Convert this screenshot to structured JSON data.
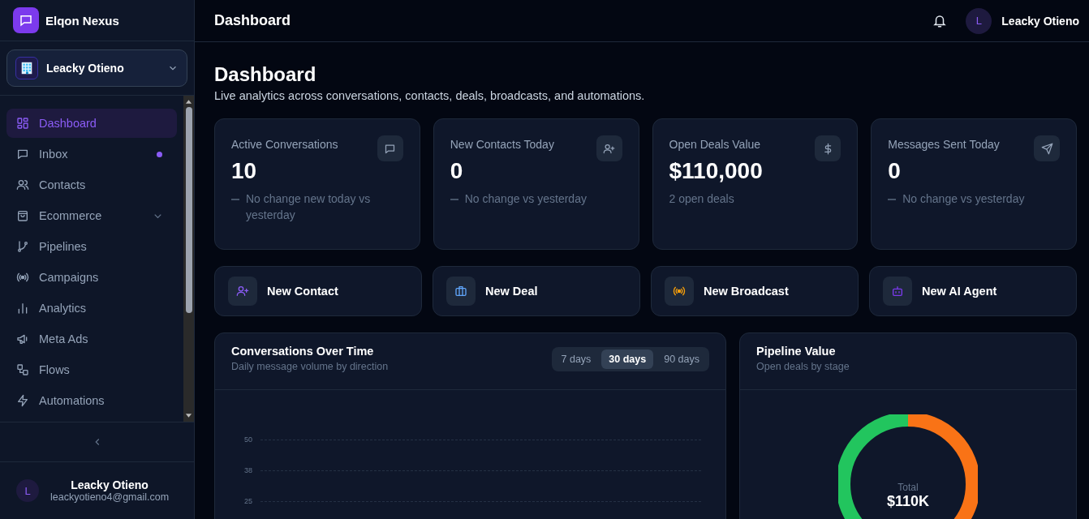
{
  "brand": {
    "name": "Elqon Nexus"
  },
  "workspace": {
    "name": "Leacky Otieno"
  },
  "sidebar": {
    "items": [
      {
        "label": "Dashboard",
        "selected": true,
        "unread": false,
        "has_submenu": false
      },
      {
        "label": "Inbox",
        "selected": false,
        "unread": true,
        "has_submenu": false
      },
      {
        "label": "Contacts",
        "selected": false,
        "unread": false,
        "has_submenu": false
      },
      {
        "label": "Ecommerce",
        "selected": false,
        "unread": false,
        "has_submenu": true
      },
      {
        "label": "Pipelines",
        "selected": false,
        "unread": false,
        "has_submenu": false
      },
      {
        "label": "Campaigns",
        "selected": false,
        "unread": false,
        "has_submenu": false
      },
      {
        "label": "Analytics",
        "selected": false,
        "unread": false,
        "has_submenu": false
      },
      {
        "label": "Meta Ads",
        "selected": false,
        "unread": false,
        "has_submenu": false
      },
      {
        "label": "Flows",
        "selected": false,
        "unread": false,
        "has_submenu": false
      },
      {
        "label": "Automations",
        "selected": false,
        "unread": false,
        "has_submenu": false
      }
    ],
    "user": {
      "initial": "L",
      "name": "Leacky Otieno",
      "email": "leackyotieno4@gmail.com"
    }
  },
  "header": {
    "title": "Dashboard",
    "user": {
      "initial": "L",
      "name": "Leacky Otieno"
    }
  },
  "page": {
    "title": "Dashboard",
    "subtitle": "Live analytics across conversations, contacts, deals, broadcasts, and automations."
  },
  "stats": [
    {
      "label": "Active Conversations",
      "value": "10",
      "flat": true,
      "note": "No change new today vs yesterday"
    },
    {
      "label": "New Contacts Today",
      "value": "0",
      "flat": true,
      "note": "No change vs yesterday"
    },
    {
      "label": "Open Deals Value",
      "value": "$110,000",
      "flat": false,
      "note": "2 open deals"
    },
    {
      "label": "Messages Sent Today",
      "value": "0",
      "flat": true,
      "note": "No change vs yesterday"
    }
  ],
  "actions": [
    {
      "label": "New Contact",
      "color": "#8b5cf6"
    },
    {
      "label": "New Deal",
      "color": "#60a5fa"
    },
    {
      "label": "New Broadcast",
      "color": "#f59e0b"
    },
    {
      "label": "New AI Agent",
      "color": "#7c3aed"
    }
  ],
  "conversations_chart": {
    "title": "Conversations Over Time",
    "subtitle": "Daily message volume by direction",
    "ranges": [
      {
        "label": "7 days",
        "selected": false
      },
      {
        "label": "30 days",
        "selected": true
      },
      {
        "label": "90 days",
        "selected": false
      }
    ],
    "y_ticks": [
      "50",
      "38",
      "25"
    ]
  },
  "pipeline_chart": {
    "title": "Pipeline Value",
    "subtitle": "Open deals by stage",
    "total_label": "Total",
    "total_value": "$110K"
  }
}
